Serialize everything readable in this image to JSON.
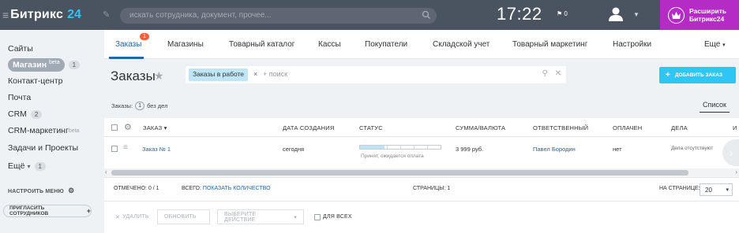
{
  "header": {
    "brand_name": "Битрикс",
    "brand_num": "24",
    "search_placeholder": "искать сотрудника, документ, прочее...",
    "clock": "17:22",
    "flag_count": "0",
    "upgrade_line1": "Расширить",
    "upgrade_line2": "Битрикс24",
    "accent": "#b42cc5"
  },
  "sidebar": {
    "items": [
      {
        "label": "Сайты"
      },
      {
        "label": "Магазин",
        "sup": "beta",
        "count": "1"
      },
      {
        "label": "Контакт-центр"
      },
      {
        "label": "Почта"
      },
      {
        "label": "CRM",
        "count": "2"
      },
      {
        "label": "CRM-маркетинг",
        "sup": "beta"
      },
      {
        "label": "Задачи и Проекты"
      },
      {
        "label": "Ещё",
        "count": "1"
      }
    ],
    "setup_menu": "НАСТРОИТЬ МЕНЮ",
    "invite": "ПРИГЛАСИТЬ СОТРУДНИКОВ"
  },
  "tabs": [
    {
      "label": "Заказы",
      "badge": "1"
    },
    {
      "label": "Магазины"
    },
    {
      "label": "Товарный каталог"
    },
    {
      "label": "Кассы"
    },
    {
      "label": "Покупатели"
    },
    {
      "label": "Складской учет"
    },
    {
      "label": "Товарный маркетинг"
    },
    {
      "label": "Настройки"
    },
    {
      "label": "Еще"
    }
  ],
  "page": {
    "title": "Заказы",
    "filter_chip": "Заказы в работе",
    "filter_placeholder": "+ поиск",
    "add_button": "ДОБАВИТЬ ЗАКАЗ",
    "deals_label": "Заказы:",
    "deals_count": "1",
    "deals_suffix": "без дел",
    "view_mode": "Список"
  },
  "grid": {
    "columns": [
      "ЗАКАЗ",
      "ДАТА СОЗДАНИЯ",
      "СТАТУС",
      "СУММА/ВАЛЮТА",
      "ОТВЕТСТВЕННЫЙ",
      "ОПЛАЧЕН",
      "ДЕЛА",
      "И"
    ],
    "rows": [
      {
        "order": "Заказ № 1",
        "date": "сегодня",
        "status": "Принят, ожидается оплата",
        "status_progress": 0.3,
        "sum": "3 999 руб.",
        "responsible": "Павел Бородин",
        "paid": "нет",
        "tasks": "Дела отсутствуют"
      }
    ]
  },
  "footer": {
    "marked": "ОТМЕЧЕНО: 0 / 1",
    "total_label": "ВСЕГО:",
    "total_link": "ПОКАЗАТЬ КОЛИЧЕСТВО",
    "pages": "СТРАНИЦЫ: 1",
    "per_page_label": "НА СТРАНИЦЕ:",
    "per_page": "20"
  },
  "actions": {
    "delete": "УДАЛИТЬ",
    "refresh": "ОБНОВИТЬ",
    "choose": "ВЫБЕРИТЕ ДЕЙСТВИЕ",
    "for_all": "ДЛЯ ВСЕХ"
  }
}
